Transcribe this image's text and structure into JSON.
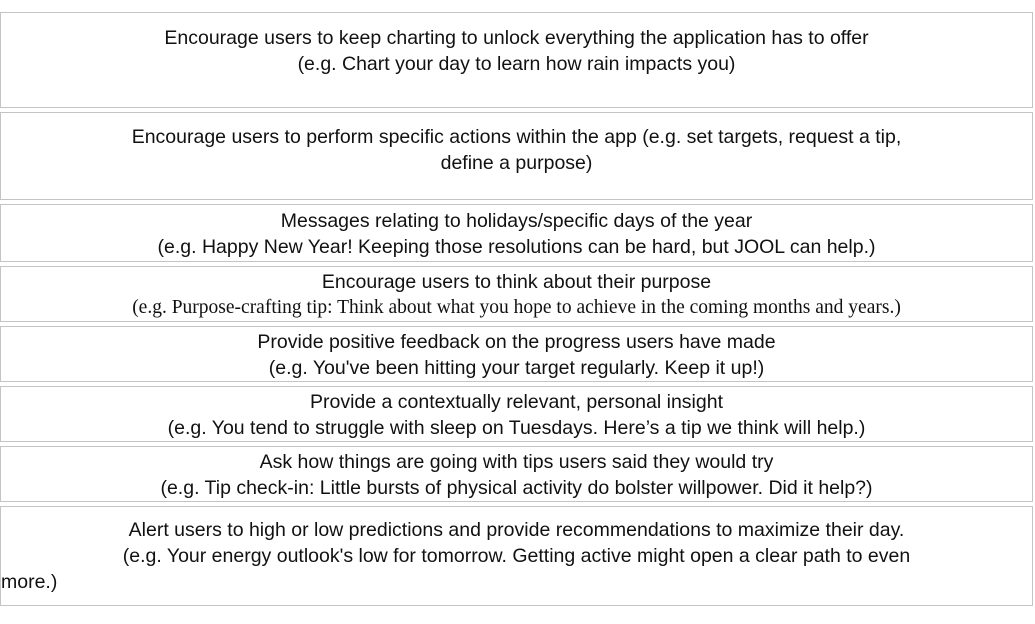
{
  "rows": [
    {
      "title": "Encourage users to keep charting to unlock everything the application has to offer",
      "example": "(e.g. Chart your day to learn how rain impacts you)"
    },
    {
      "title": "Encourage users to perform specific actions within the app (e.g. set targets, request a tip,",
      "example": "define a purpose)"
    },
    {
      "title": "Messages relating to holidays/specific days of the year",
      "example": "(e.g. Happy New Year! Keeping those resolutions can be hard, but JOOL can help.)"
    },
    {
      "title": "Encourage users to think about their purpose",
      "example": "(e.g. Purpose-crafting tip: Think about what you hope to achieve in the coming months and years.)"
    },
    {
      "title": "Provide positive feedback on the progress users have made",
      "example": "(e.g. You've been hitting your target regularly. Keep it up!)"
    },
    {
      "title": "Provide a contextually relevant, personal insight",
      "example": "(e.g. You tend to struggle with sleep on Tuesdays. Here’s a tip we think will help.)"
    },
    {
      "title": "Ask how things are going with tips users said they would try",
      "example": "(e.g. Tip check-in: Little bursts of physical activity do bolster willpower. Did it help?)"
    },
    {
      "title": "Alert users to high or low predictions and provide recommendations to maximize their day.",
      "example_line1": "(e.g. Your energy outlook's low for tomorrow. Getting active might open a clear path to even",
      "example_line2": "more.)"
    }
  ]
}
